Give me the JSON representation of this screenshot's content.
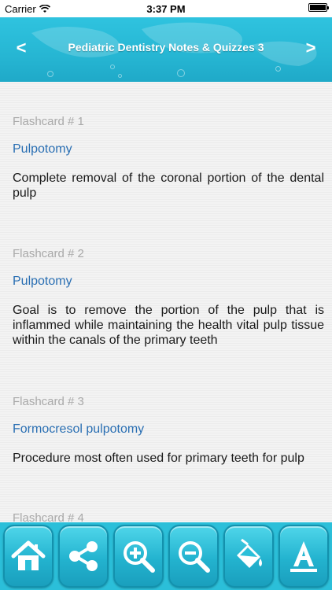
{
  "status_bar": {
    "carrier": "Carrier",
    "time": "3:37 PM"
  },
  "header": {
    "title": "Pediatric Dentistry Notes & Quizzes 3",
    "prev_label": "<",
    "next_label": ">",
    "background_color": "#2bbfd9"
  },
  "flashcards": [
    {
      "number": "Flashcard # 1",
      "term": "Pulpotomy",
      "definition": "Complete removal of the coronal portion of the dental pulp"
    },
    {
      "number": "Flashcard # 2",
      "term": "Pulpotomy",
      "definition": "Goal is to remove the portion of the pulp that is inflammed while maintaining the health vital pulp tissue within the canals of the primary teeth"
    },
    {
      "number": "Flashcard # 3",
      "term": "Formocresol pulpotomy",
      "definition": "Procedure most often used for primary teeth for pulp"
    },
    {
      "number": "Flashcard # 4",
      "term": "",
      "definition": ""
    }
  ],
  "toolbar": {
    "buttons": [
      {
        "icon": "home-icon"
      },
      {
        "icon": "share-icon"
      },
      {
        "icon": "zoom-in-icon"
      },
      {
        "icon": "zoom-out-icon"
      },
      {
        "icon": "paint-bucket-icon"
      },
      {
        "icon": "font-icon"
      }
    ]
  },
  "colors": {
    "term": "#2a6fb3",
    "card_number": "#a9a9a9",
    "accent": "#2bbfd9"
  }
}
